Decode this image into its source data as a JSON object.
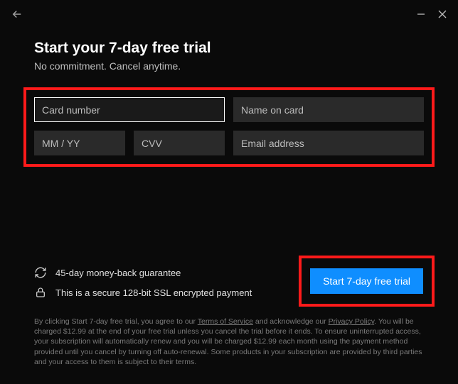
{
  "header": {
    "title": "Start your 7-day free trial",
    "subtitle": "No commitment. Cancel anytime."
  },
  "form": {
    "card_number": {
      "value": "",
      "placeholder": "Card number"
    },
    "name_on_card": {
      "value": "",
      "placeholder": "Name on card"
    },
    "expiry": {
      "value": "",
      "placeholder": "MM / YY"
    },
    "cvv": {
      "value": "",
      "placeholder": "CVV"
    },
    "email": {
      "value": "",
      "placeholder": "Email address"
    }
  },
  "assurance": {
    "money_back": "45-day money-back guarantee",
    "secure": "This is a secure 128-bit SSL encrypted payment"
  },
  "cta": {
    "label": "Start 7-day free trial"
  },
  "legal": {
    "pre": "By clicking Start 7-day free trial, you agree to our ",
    "tos": "Terms of Service",
    "mid1": " and acknowledge our ",
    "pp": "Privacy Policy",
    "post": ". You will be charged $12.99 at the end of your free trial unless you cancel the trial before it ends. To ensure uninterrupted access, your subscription will automatically renew and you will be charged $12.99 each month using the payment method provided until you cancel by turning off auto-renewal. Some products in your subscription are provided by third parties and your access to them is subject to their terms."
  },
  "colors": {
    "highlight": "#ff1a1a",
    "accent": "#0f8eff"
  }
}
